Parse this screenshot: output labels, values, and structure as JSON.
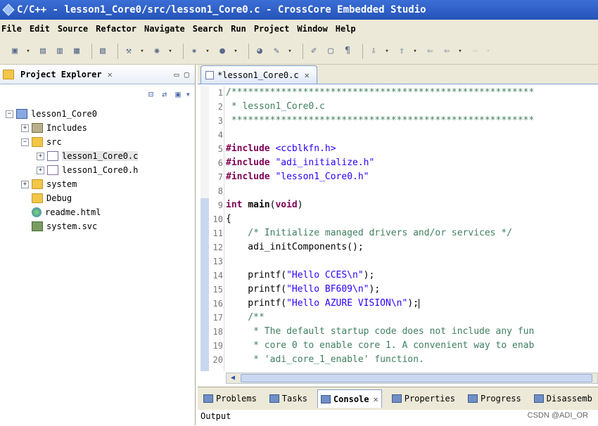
{
  "window": {
    "title": "C/C++ - lesson1_Core0/src/lesson1_Core0.c - CrossCore Embedded Studio"
  },
  "menu": [
    "File",
    "Edit",
    "Source",
    "Refactor",
    "Navigate",
    "Search",
    "Run",
    "Project",
    "Window",
    "Help"
  ],
  "project_explorer": {
    "tab_label": "Project Explorer",
    "tree": [
      {
        "label": "lesson1_Core0",
        "icon": "project-icon",
        "expand": "−",
        "indent": 0
      },
      {
        "label": "Includes",
        "icon": "includes-icon",
        "expand": "+",
        "indent": 1
      },
      {
        "label": "src",
        "icon": "folder-icon",
        "expand": "−",
        "indent": 1
      },
      {
        "label": "lesson1_Core0.c",
        "icon": "c-file-icon",
        "expand": "+",
        "indent": 2
      },
      {
        "label": "lesson1_Core0.h",
        "icon": "h-file-icon",
        "expand": "+",
        "indent": 2
      },
      {
        "label": "system",
        "icon": "folder-icon",
        "expand": "+",
        "indent": 1
      },
      {
        "label": "Debug",
        "icon": "folder-icon",
        "expand": "",
        "indent": 1
      },
      {
        "label": "readme.html",
        "icon": "web-icon",
        "expand": "",
        "indent": 1
      },
      {
        "label": "system.svc",
        "icon": "svc-icon",
        "expand": "",
        "indent": 1
      }
    ]
  },
  "editor": {
    "tab_label": "*lesson1_Core0.c",
    "lines": [
      {
        "n": "1",
        "text": "/*******************************************************"
      },
      {
        "n": "2",
        "text": " * lesson1_Core0.c"
      },
      {
        "n": "3",
        "text": " *******************************************************"
      },
      {
        "n": "4",
        "text": ""
      },
      {
        "n": "5",
        "text": "#include <ccblkfn.h>"
      },
      {
        "n": "6",
        "text": "#include \"adi_initialize.h\""
      },
      {
        "n": "7",
        "text": "#include \"lesson1_Core0.h\""
      },
      {
        "n": "8",
        "text": ""
      },
      {
        "n": "9",
        "text": "int main(void)"
      },
      {
        "n": "10",
        "text": "{"
      },
      {
        "n": "11",
        "text": "    /* Initialize managed drivers and/or services */"
      },
      {
        "n": "12",
        "text": "    adi_initComponents();"
      },
      {
        "n": "13",
        "text": ""
      },
      {
        "n": "14",
        "text": "    printf(\"Hello CCES\\n\");"
      },
      {
        "n": "15",
        "text": "    printf(\"Hello BF609\\n\");"
      },
      {
        "n": "16",
        "text": "    printf(\"Hello AZURE VISION\\n\");"
      },
      {
        "n": "17",
        "text": "    /**"
      },
      {
        "n": "18",
        "text": "     * The default startup code does not include any fun"
      },
      {
        "n": "19",
        "text": "     * core 0 to enable core 1. A convenient way to enab"
      },
      {
        "n": "20",
        "text": "     * 'adi_core_1_enable' function."
      }
    ]
  },
  "bottom_panel": {
    "tabs": [
      "Problems",
      "Tasks",
      "Console",
      "Properties",
      "Progress",
      "Disassemb"
    ],
    "active": "Console",
    "output_label": "Output"
  },
  "watermark": "CSDN @ADI_OR"
}
